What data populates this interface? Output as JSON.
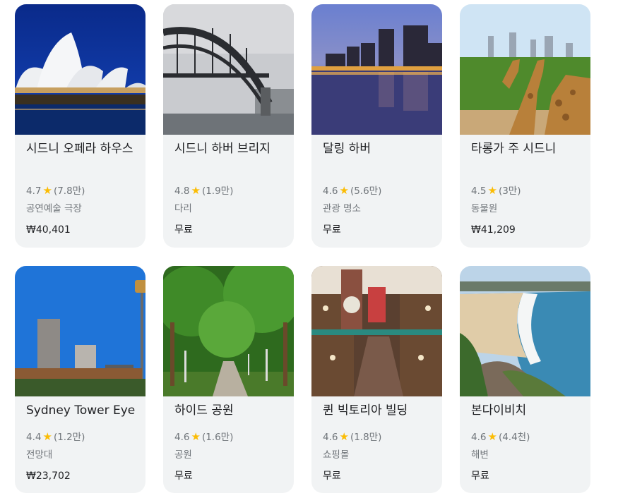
{
  "places": [
    {
      "title": "시드니 오페라 하우스",
      "rating": "4.7",
      "reviews": "(7.8만)",
      "category": "공연예술 극장",
      "price": "₩40,401",
      "image": "sydney-opera-house-night"
    },
    {
      "title": "시드니 하버 브리지",
      "rating": "4.8",
      "reviews": "(1.9만)",
      "category": "다리",
      "price": "무료",
      "image": "harbour-bridge-cloudy"
    },
    {
      "title": "달링 하버",
      "rating": "4.6",
      "reviews": "(5.6만)",
      "category": "관광 명소",
      "price": "무료",
      "image": "darling-harbour-dusk"
    },
    {
      "title": "타롱가 주 시드니",
      "rating": "4.5",
      "reviews": "(3만)",
      "category": "동물원",
      "price": "₩41,209",
      "image": "giraffes-skyline"
    },
    {
      "title": "Sydney Tower Eye",
      "rating": "4.4",
      "reviews": "(1.2만)",
      "category": "전망대",
      "price": "₩23,702",
      "image": "sydney-tower-skyline"
    },
    {
      "title": "하이드 공원",
      "rating": "4.6",
      "reviews": "(1.6만)",
      "category": "공원",
      "price": "무료",
      "image": "hyde-park-avenue"
    },
    {
      "title": "퀸 빅토리아 빌딩",
      "rating": "4.6",
      "reviews": "(1.8만)",
      "category": "쇼핑몰",
      "price": "무료",
      "image": "qvb-interior"
    },
    {
      "title": "본다이비치",
      "rating": "4.6",
      "reviews": "(4.4천)",
      "category": "해변",
      "price": "무료",
      "image": "bondi-beach-aerial"
    }
  ],
  "star_symbol": "★",
  "colors": {
    "card_bg": "#f1f3f4",
    "star": "#fbbc04",
    "title": "#202124",
    "meta": "#70757a"
  }
}
